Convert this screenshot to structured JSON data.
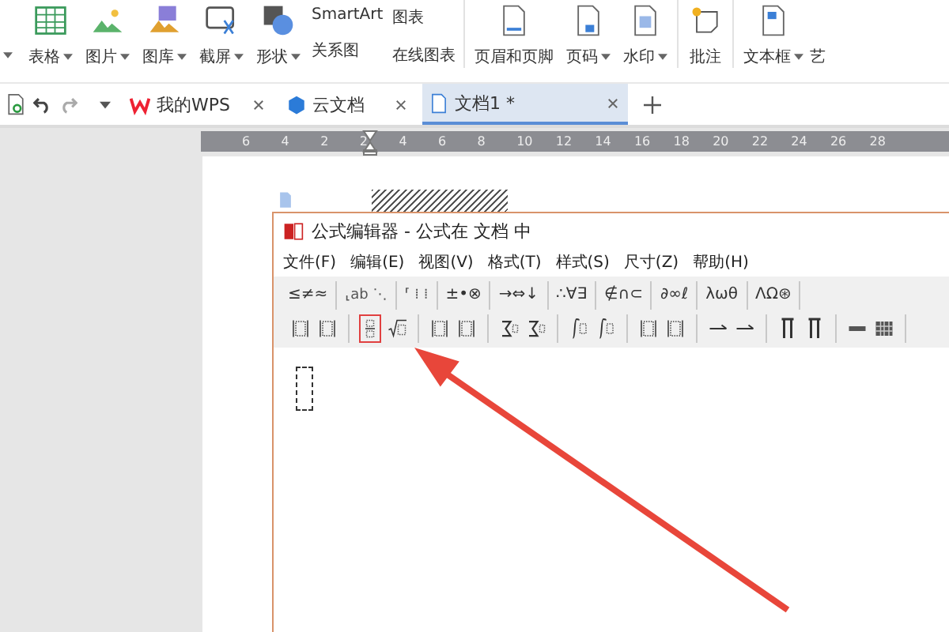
{
  "ribbon": {
    "items": [
      {
        "kind": "table",
        "label": "表格",
        "dropdown": true
      },
      {
        "kind": "picture",
        "label": "图片",
        "dropdown": true
      },
      {
        "kind": "gallery",
        "label": "图库",
        "dropdown": true
      },
      {
        "kind": "screenshot",
        "label": "截屏",
        "dropdown": true
      },
      {
        "kind": "shape",
        "label": "形状",
        "dropdown": true
      },
      {
        "kind": "stack",
        "top": "SmartArt",
        "bottom": "关系图"
      },
      {
        "kind": "stack",
        "top": "图表",
        "bottom": "在线图表"
      },
      {
        "kind": "header",
        "label": "页眉和页脚",
        "dropdown": false
      },
      {
        "kind": "pagenum",
        "label": "页码",
        "dropdown": true
      },
      {
        "kind": "watermark",
        "label": "水印",
        "dropdown": true
      },
      {
        "kind": "comment",
        "label": "批注",
        "dropdown": false
      },
      {
        "kind": "textbox",
        "label": "文本框",
        "dropdown": true
      },
      {
        "kind": "cut",
        "label": "艺",
        "dropdown": false
      }
    ]
  },
  "tabs": [
    {
      "label": "我的WPS",
      "kind": "wps",
      "selected": false
    },
    {
      "label": "云文档",
      "kind": "cloud",
      "selected": false
    },
    {
      "label": "文档1 *",
      "kind": "doc",
      "selected": true
    }
  ],
  "ruler": {
    "labels": [
      "6",
      "4",
      "2",
      "2",
      "4",
      "6",
      "8",
      "10",
      "12",
      "14",
      "16",
      "18",
      "20",
      "22",
      "24",
      "26",
      "28"
    ]
  },
  "editor": {
    "title": "公式编辑器 - 公式在 文档 中",
    "menu": [
      "文件(F)",
      "编辑(E)",
      "视图(V)",
      "格式(T)",
      "样式(S)",
      "尺寸(Z)",
      "帮助(H)"
    ],
    "palette_row1": [
      {
        "kind": "symbols",
        "text": "≤≠≈"
      },
      {
        "kind": "template",
        "text": "⸤ab ⋱"
      },
      {
        "kind": "template",
        "text": "⸢ ⁞ ⁞"
      },
      {
        "kind": "symbols",
        "text": "±•⊗"
      },
      {
        "kind": "symbols",
        "text": "→⇔↓"
      },
      {
        "kind": "symbols",
        "text": "∴∀∃"
      },
      {
        "kind": "symbols",
        "text": "∉∩⊂"
      },
      {
        "kind": "symbols",
        "text": "∂∞ℓ"
      },
      {
        "kind": "symbols",
        "text": "λωθ"
      },
      {
        "kind": "symbols",
        "text": "ΛΩ⊛"
      }
    ],
    "palette_row2": [
      {
        "buttons": [
          {
            "kind": "fence",
            "selected": false
          },
          {
            "kind": "bracket",
            "selected": false
          }
        ]
      },
      {
        "buttons": [
          {
            "kind": "fraction",
            "selected": true
          },
          {
            "kind": "radical",
            "selected": false
          }
        ]
      },
      {
        "buttons": [
          {
            "kind": "script",
            "selected": false
          },
          {
            "kind": "underover",
            "selected": false
          }
        ]
      },
      {
        "buttons": [
          {
            "kind": "sum",
            "selected": false
          },
          {
            "kind": "sum",
            "selected": false
          }
        ]
      },
      {
        "buttons": [
          {
            "kind": "integral",
            "selected": false
          },
          {
            "kind": "integral",
            "selected": false
          }
        ]
      },
      {
        "buttons": [
          {
            "kind": "overbar",
            "selected": false
          },
          {
            "kind": "underbar",
            "selected": false
          }
        ]
      },
      {
        "buttons": [
          {
            "kind": "arrow",
            "selected": false
          },
          {
            "kind": "arrow",
            "selected": false
          }
        ]
      },
      {
        "buttons": [
          {
            "kind": "product",
            "selected": false
          },
          {
            "kind": "product",
            "selected": false
          }
        ]
      },
      {
        "buttons": [
          {
            "kind": "dots",
            "selected": false
          },
          {
            "kind": "matrix",
            "selected": false
          }
        ]
      }
    ]
  }
}
